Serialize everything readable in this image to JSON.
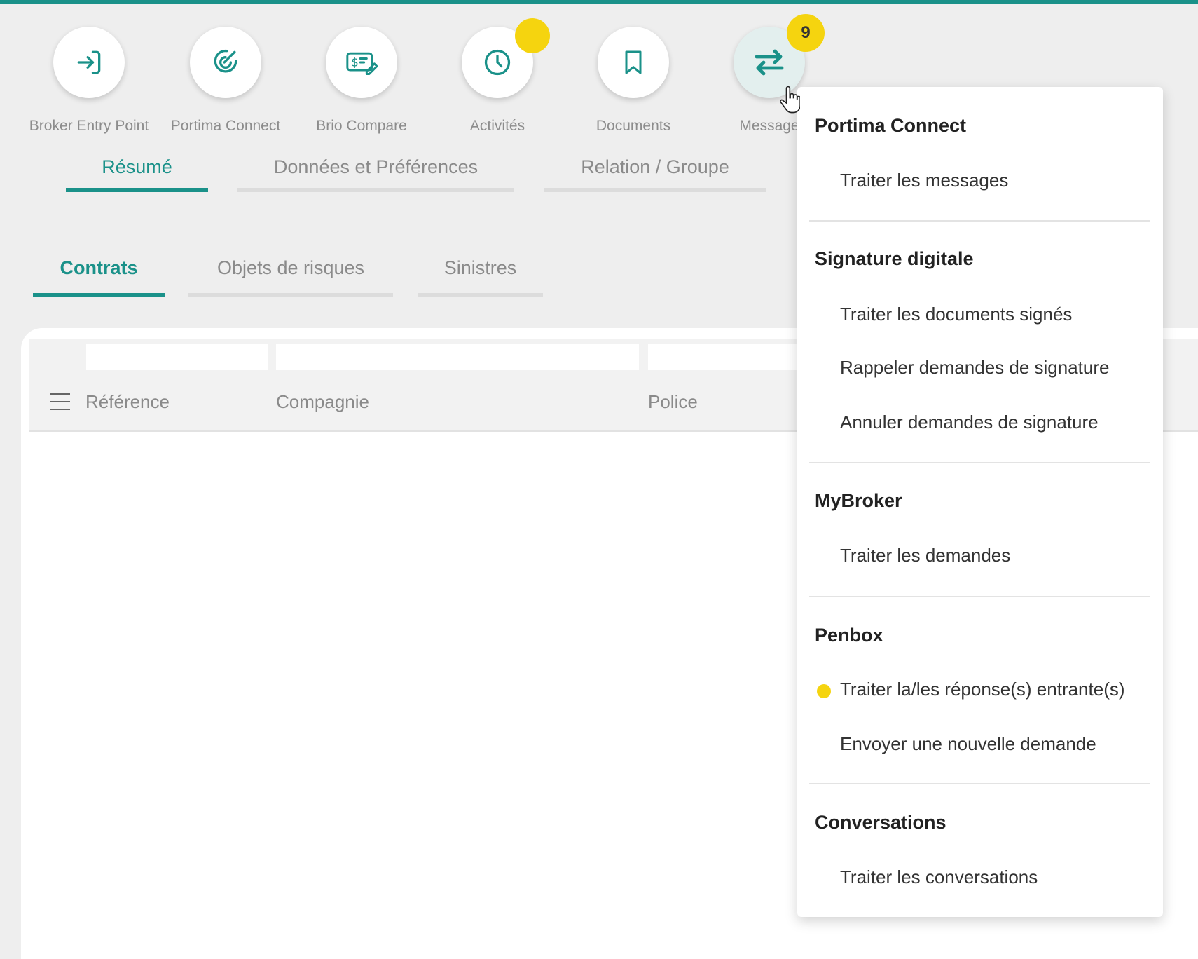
{
  "toolbar": {
    "items": [
      {
        "label": "Broker Entry Point",
        "icon": "login-arrow-icon"
      },
      {
        "label": "Portima Connect",
        "icon": "target-check-icon"
      },
      {
        "label": "Brio Compare",
        "icon": "dollar-edit-icon"
      },
      {
        "label": "Activités",
        "icon": "clock-icon"
      },
      {
        "label": "Documents",
        "icon": "bookmark-icon"
      },
      {
        "label": "Message",
        "icon": "swap-arrows-icon"
      }
    ],
    "messages_badge_count": "9"
  },
  "main_tabs": [
    {
      "label": "Résumé",
      "active": true
    },
    {
      "label": "Données et Préférences",
      "active": false
    },
    {
      "label": "Relation / Groupe",
      "active": false
    }
  ],
  "sub_tabs": [
    {
      "label": "Contrats",
      "active": true
    },
    {
      "label": "Objets de risques",
      "active": false
    },
    {
      "label": "Sinistres",
      "active": false
    }
  ],
  "table": {
    "columns": [
      "Référence",
      "Compagnie",
      "Police"
    ]
  },
  "dropdown": {
    "sections": [
      {
        "title": "Portima Connect",
        "items": [
          "Traiter les messages"
        ]
      },
      {
        "title": "Signature digitale",
        "items": [
          "Traiter les documents signés",
          "Rappeler demandes de signature",
          "Annuler demandes de signature"
        ]
      },
      {
        "title": "MyBroker",
        "items": [
          "Traiter les demandes"
        ]
      },
      {
        "title": "Penbox",
        "items": [
          "Traiter la/les réponse(s) entrante(s)",
          "Envoyer une nouvelle demande"
        ]
      },
      {
        "title": "Conversations",
        "items": [
          "Traiter les conversations"
        ]
      }
    ]
  },
  "colors": {
    "accent": "#1a9189",
    "badge": "#f5d40f"
  }
}
